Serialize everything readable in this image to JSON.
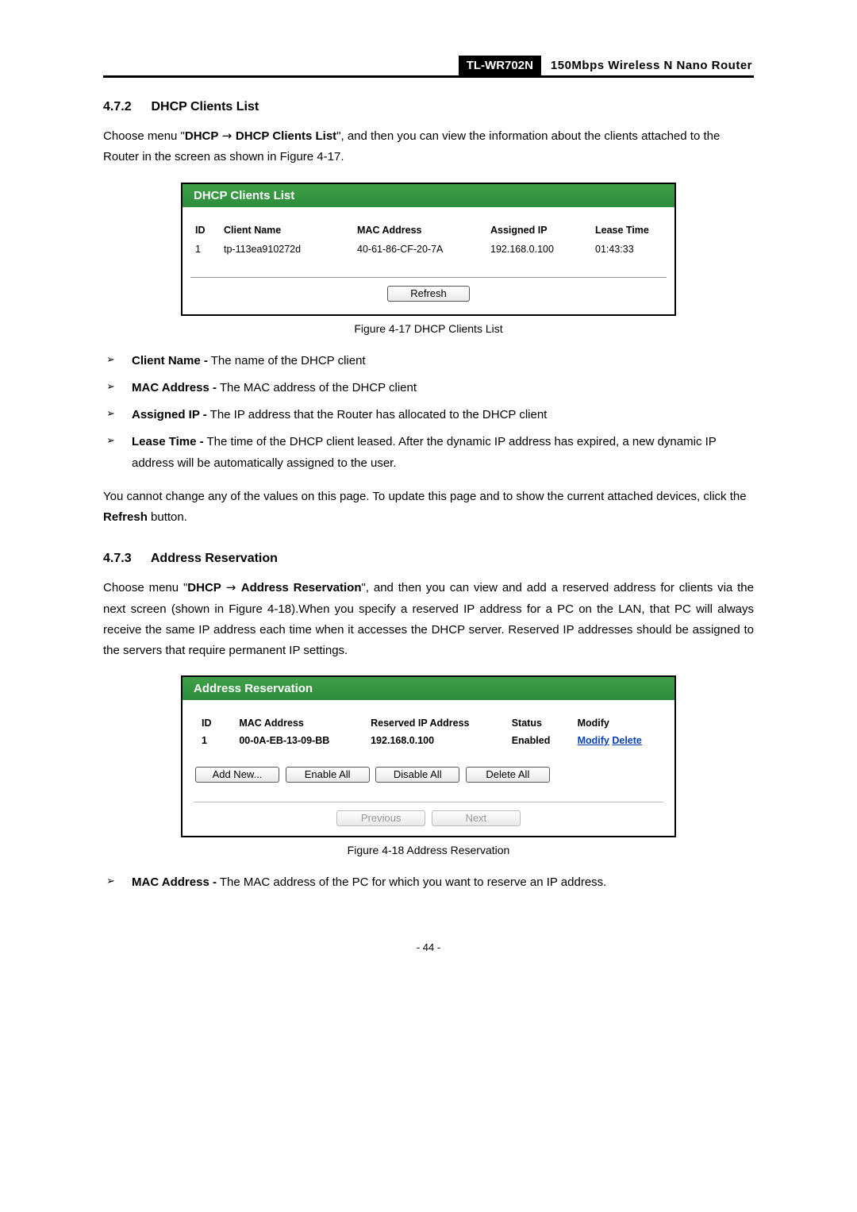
{
  "header": {
    "model": "TL-WR702N",
    "tagline": "150Mbps Wireless N Nano Router"
  },
  "sec1": {
    "num": "4.7.2",
    "title": "DHCP Clients List",
    "para1_a": "Choose menu \"",
    "para1_b": "DHCP",
    "para1_c": "DHCP Clients List",
    "para1_d": "\", and then you can view the information about the clients attached to the Router in the screen as shown in Figure 4-17."
  },
  "fig1": {
    "title": "DHCP Clients List",
    "cols": {
      "id": "ID",
      "name": "Client Name",
      "mac": "MAC Address",
      "ip": "Assigned IP",
      "lease": "Lease Time"
    },
    "row": {
      "id": "1",
      "name": "tp-113ea910272d",
      "mac": "40-61-86-CF-20-7A",
      "ip": "192.168.0.100",
      "lease": "01:43:33"
    },
    "refresh": "Refresh",
    "caption": "Figure 4-17   DHCP Clients List"
  },
  "defs1": {
    "a_t": "Client Name -",
    "a_d": "The name of the DHCP client",
    "b_t": "MAC Address -",
    "b_d": "The MAC address of the DHCP client",
    "c_t": "Assigned IP -",
    "c_d": "The IP address that the Router has allocated to the DHCP client",
    "d_t": "Lease Time -",
    "d_d": "The time of the DHCP client leased. After the dynamic IP address has expired, a new dynamic IP address will be automatically assigned to the user."
  },
  "note1_a": "You cannot change any of the values on this page. To update this page and to show the current attached devices, click the ",
  "note1_b": "Refresh",
  "note1_c": " button.",
  "sec2": {
    "num": "4.7.3",
    "title": "Address Reservation",
    "para_a": "Choose menu \"",
    "para_b": "DHCP",
    "para_c": "Address Reservation",
    "para_d": "\", and then you can view and add a reserved address for clients via the next screen (shown in Figure 4-18).When you specify a reserved IP address for a PC on the LAN, that PC will always receive the same IP address each time when it accesses the DHCP server. Reserved IP addresses should be assigned to the servers that require permanent IP settings."
  },
  "fig2": {
    "title": "Address Reservation",
    "cols": {
      "id": "ID",
      "mac": "MAC Address",
      "ip": "Reserved IP Address",
      "status": "Status",
      "modify": "Modify"
    },
    "row": {
      "id": "1",
      "mac": "00-0A-EB-13-09-BB",
      "ip": "192.168.0.100",
      "status": "Enabled",
      "mod": "Modify",
      "del": "Delete"
    },
    "btns": {
      "add": "Add New...",
      "en": "Enable All",
      "dis": "Disable All",
      "del": "Delete All",
      "prev": "Previous",
      "next": "Next"
    },
    "caption": "Figure 4-18   Address Reservation"
  },
  "defs2": {
    "a_t": "MAC Address -",
    "a_d": "The MAC address of the PC for which you want to reserve an IP address."
  },
  "pagenum": "- 44 -"
}
